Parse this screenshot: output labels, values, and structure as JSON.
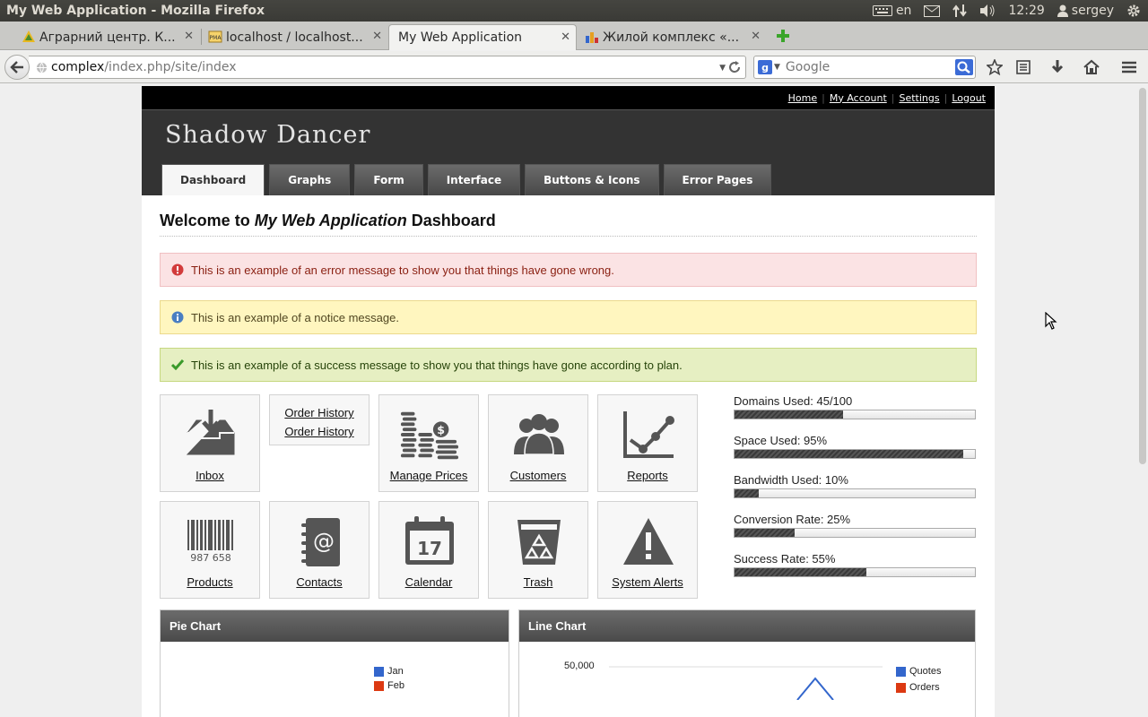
{
  "os": {
    "window_title": "My Web Application - Mozilla Firefox",
    "keyboard_layout": "en",
    "clock": "12:29",
    "user": "sergey"
  },
  "browser": {
    "tabs": [
      {
        "label": "Аграрний центр. К..."
      },
      {
        "label": "localhost / localhost..."
      },
      {
        "label": "My Web Application"
      },
      {
        "label": "Жилой комплекс «..."
      }
    ],
    "url_host": "complex",
    "url_path": "/index.php/site/index",
    "search_placeholder": "Google"
  },
  "app": {
    "top_links": [
      "Home",
      "My Account",
      "Settings",
      "Logout"
    ],
    "brand": "Shadow Dancer",
    "nav": [
      "Dashboard",
      "Graphs",
      "Form",
      "Interface",
      "Buttons & Icons",
      "Error Pages"
    ],
    "welcome_prefix": "Welcome to ",
    "welcome_app": "My Web Application",
    "welcome_suffix": " Dashboard",
    "messages": {
      "error": "This is an example of an error message to show you that things have gone wrong.",
      "notice": "This is an example of a notice message.",
      "success": "This is an example of a success message to show you that things have gone according to plan."
    },
    "tiles": {
      "inbox": "Inbox",
      "order_history_1": "Order History",
      "order_history_2": "Order History",
      "manage_prices": "Manage Prices",
      "customers": "Customers",
      "reports": "Reports",
      "products": "Products",
      "contacts": "Contacts",
      "calendar": "Calendar",
      "calendar_day": "17",
      "trash": "Trash",
      "system_alerts": "System Alerts",
      "barcode_digits": "987 658"
    },
    "stats": [
      {
        "label": "Domains Used: 45/100",
        "fraction": 0.45
      },
      {
        "label": "Space Used: 95%",
        "fraction": 0.95
      },
      {
        "label": "Bandwidth Used: 10%",
        "fraction": 0.1
      },
      {
        "label": "Conversion Rate: 25%",
        "fraction": 0.25
      },
      {
        "label": "Success Rate: 55%",
        "fraction": 0.55
      }
    ],
    "pie_panel": {
      "title": "Pie Chart",
      "legend": [
        "Jan",
        "Feb"
      ]
    },
    "line_panel": {
      "title": "Line Chart",
      "y_tick": "50,000",
      "legend": [
        "Quotes",
        "Orders"
      ]
    },
    "colors": {
      "legend_blue": "#3366cc",
      "legend_red": "#dc3912"
    }
  }
}
